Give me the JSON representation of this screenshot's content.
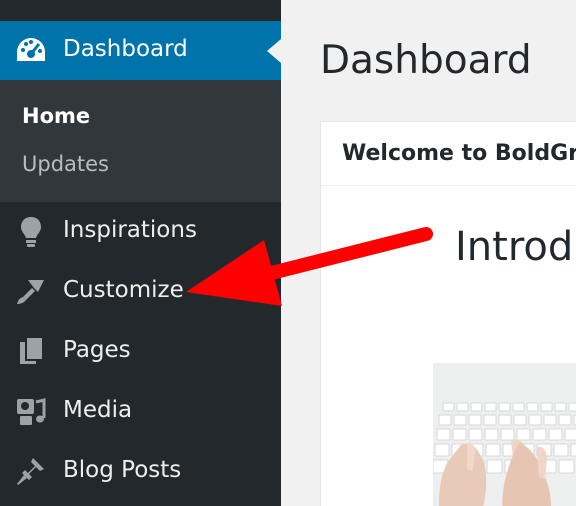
{
  "sidebar": {
    "dashboard": {
      "label": "Dashboard",
      "icon": "dashboard-gauge-icon",
      "active_color": "#0073aa"
    },
    "submenu": [
      {
        "label": "Home",
        "current": true
      },
      {
        "label": "Updates",
        "current": false
      }
    ],
    "items": [
      {
        "label": "Inspirations",
        "icon": "lightbulb-icon"
      },
      {
        "label": "Customize",
        "icon": "paintbrush-icon"
      },
      {
        "label": "Pages",
        "icon": "pages-icon"
      },
      {
        "label": "Media",
        "icon": "media-icon"
      },
      {
        "label": "Blog Posts",
        "icon": "pushpin-icon"
      }
    ]
  },
  "main": {
    "page_title": "Dashboard",
    "widget": {
      "title": "Welcome to BoldGr",
      "heading": "Introdu"
    }
  },
  "annotation": {
    "color": "#ff0000"
  }
}
